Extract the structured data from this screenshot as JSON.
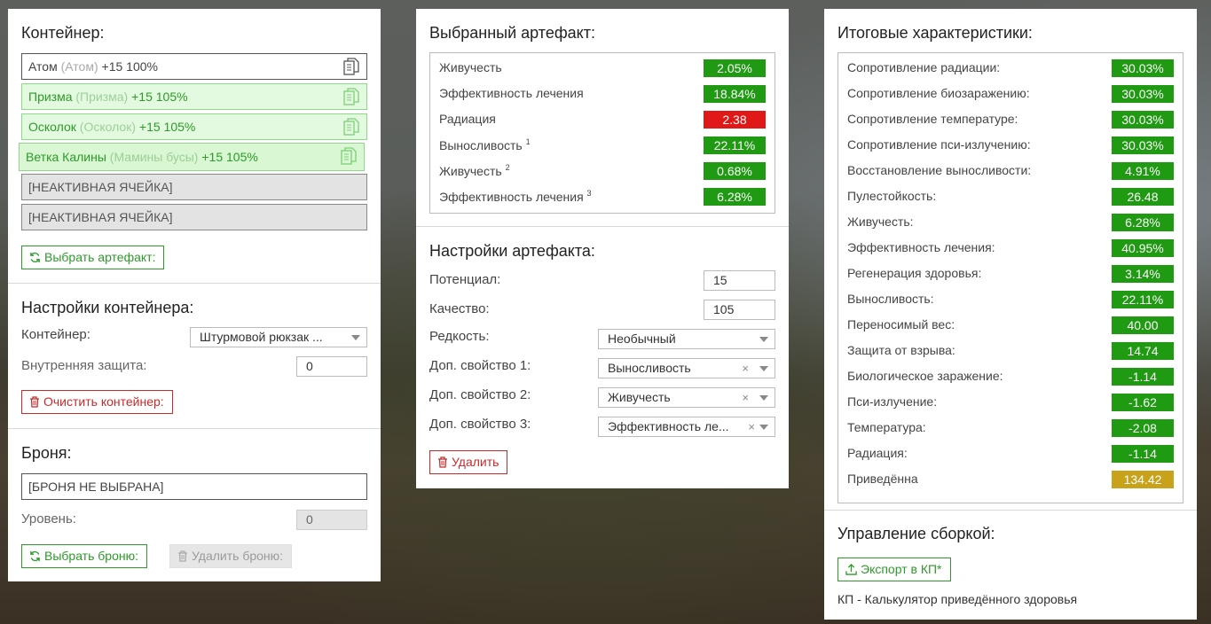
{
  "container": {
    "title": "Контейнер:",
    "slots": [
      {
        "name": "Атом",
        "alias": "(Атом)",
        "level": "+15 100%"
      },
      {
        "name": "Призма",
        "alias": "(Призма)",
        "level": "+15 105%"
      },
      {
        "name": "Осколок",
        "alias": "(Осколок)",
        "level": "+15 105%"
      },
      {
        "name": "Ветка Калины",
        "alias": "(Мамины бусы)",
        "level": "+15 105%"
      },
      {
        "name": "[НЕАКТИВНАЯ ЯЧЕЙКА]"
      },
      {
        "name": "[НЕАКТИВНАЯ ЯЧЕЙКА]"
      }
    ],
    "select_artifact_label": "Выбрать артефакт:"
  },
  "container_settings": {
    "title": "Настройки контейнера:",
    "container_label": "Контейнер:",
    "container_value": "Штурмовой рюкзак ...",
    "protection_label": "Внутренняя защита:",
    "protection_value": "0",
    "clear_label": "Очистить контейнер:"
  },
  "armor": {
    "title": "Броня:",
    "value": "[БРОНЯ НЕ ВЫБРАНА]",
    "level_label": "Уровень:",
    "level_value": "0",
    "select_label": "Выбрать броню:",
    "delete_label": "Удалить броню:"
  },
  "selected_artifact": {
    "title": "Выбранный артефакт:",
    "stats": [
      {
        "name": "Живучесть",
        "sup": "",
        "value": "2.05%",
        "color": "green"
      },
      {
        "name": "Эффективность лечения",
        "sup": "",
        "value": "18.84%",
        "color": "green"
      },
      {
        "name": "Радиация",
        "sup": "",
        "value": "2.38",
        "color": "red"
      },
      {
        "name": "Выносливость",
        "sup": "1",
        "value": "22.11%",
        "color": "green"
      },
      {
        "name": "Живучесть",
        "sup": "2",
        "value": "0.68%",
        "color": "green"
      },
      {
        "name": "Эффективность лечения",
        "sup": "3",
        "value": "6.28%",
        "color": "green"
      }
    ]
  },
  "artifact_settings": {
    "title": "Настройки артефакта:",
    "potential_label": "Потенциал:",
    "potential_value": "15",
    "quality_label": "Качество:",
    "quality_value": "105",
    "rarity_label": "Редкость:",
    "rarity_value": "Необычный",
    "extra1_label": "Доп. свойство 1:",
    "extra1_value": "Выносливость",
    "extra2_label": "Доп. свойство 2:",
    "extra2_value": "Живучесть",
    "extra3_label": "Доп. свойство 3:",
    "extra3_value": "Эффективность ле...",
    "delete_label": "Удалить"
  },
  "totals": {
    "title": "Итоговые характеристики:",
    "stats": [
      {
        "name": "Сопротивление радиации:",
        "value": "30.03%",
        "color": "green"
      },
      {
        "name": "Сопротивление биозаражению:",
        "value": "30.03%",
        "color": "green"
      },
      {
        "name": "Сопротивление температуре:",
        "value": "30.03%",
        "color": "green"
      },
      {
        "name": "Сопротивление пси-излучению:",
        "value": "30.03%",
        "color": "green"
      },
      {
        "name": "Восстановление выносливости:",
        "value": "4.91%",
        "color": "green"
      },
      {
        "name": "Пулестойкость:",
        "value": "26.48",
        "color": "green"
      },
      {
        "name": "Живучесть:",
        "value": "6.28%",
        "color": "green"
      },
      {
        "name": "Эффективность лечения:",
        "value": "40.95%",
        "color": "green"
      },
      {
        "name": "Регенерация здоровья:",
        "value": "3.14%",
        "color": "green"
      },
      {
        "name": "Выносливость:",
        "value": "22.11%",
        "color": "green"
      },
      {
        "name": "Переносимый вес:",
        "value": "40.00",
        "color": "green"
      },
      {
        "name": "Защита от взрыва:",
        "value": "14.74",
        "color": "green"
      },
      {
        "name": "Биологическое заражение:",
        "value": "-1.14",
        "color": "green"
      },
      {
        "name": "Пси-излучение:",
        "value": "-1.62",
        "color": "green"
      },
      {
        "name": "Температура:",
        "value": "-2.08",
        "color": "green"
      },
      {
        "name": "Радиация:",
        "value": "-1.14",
        "color": "green"
      },
      {
        "name": "Приведённа",
        "value": "134.42",
        "color": "gold"
      }
    ]
  },
  "build": {
    "title": "Управление сборкой:",
    "export_label": "Экспорт в КП*",
    "note": "КП - Калькулятор приведённого здоровья"
  },
  "colors": {
    "green": "#1f9a12",
    "red": "#e01818",
    "gold": "#c9a21c",
    "accent": "#2e9a2a"
  }
}
